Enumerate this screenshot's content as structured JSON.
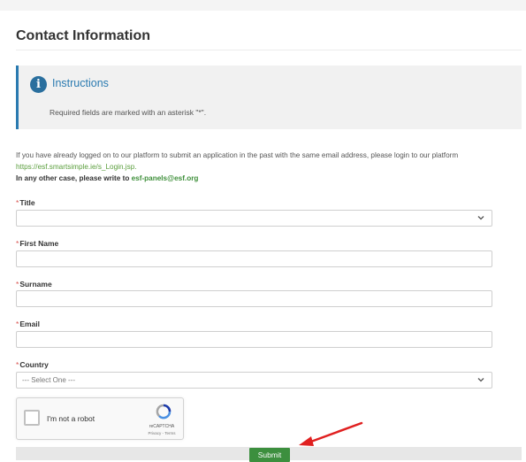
{
  "page": {
    "title": "Contact Information"
  },
  "instructions": {
    "title": "Instructions",
    "text": "Required fields are marked with an asterisk \"*\"."
  },
  "intro": {
    "line1": "If you have already logged on to our platform to submit an application in the past with the same email address, please login to our platform",
    "link": "https://esf.smartsimple.ie/s_Login.jsp.",
    "line2_prefix": "In any other case, please write to",
    "line2_email": "esf-panels@esf.org"
  },
  "form": {
    "required_mark": "*",
    "title": {
      "label": "Title",
      "value": ""
    },
    "first_name": {
      "label": "First Name",
      "value": ""
    },
    "surname": {
      "label": "Surname",
      "value": ""
    },
    "email": {
      "label": "Email",
      "value": ""
    },
    "country": {
      "label": "Country",
      "value": "--- Select One ---"
    }
  },
  "captcha": {
    "label": "I'm not a robot",
    "brand": "reCAPTCHA",
    "terms": "Privacy - Terms"
  },
  "submit": {
    "label": "Submit"
  },
  "colors": {
    "accent_blue": "#2a7ab0",
    "link_green": "#5a9e3c",
    "submit_green": "#3c8f3e",
    "required_red": "#d9534f",
    "annotation_arrow": "#e02020"
  },
  "icons": {
    "instructions": "info-icon",
    "select": "chevron-down-icon",
    "captcha": "recaptcha-logo-icon",
    "annotation": "red-arrow-icon"
  }
}
